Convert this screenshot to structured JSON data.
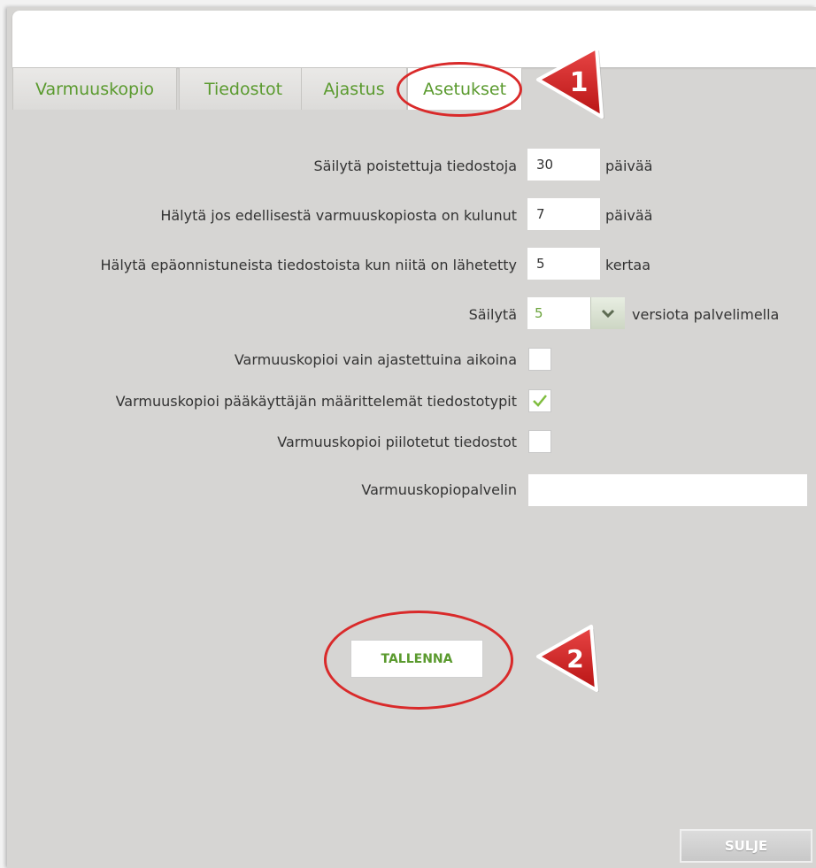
{
  "tabs": [
    {
      "label": "Varmuuskopio"
    },
    {
      "label": "Tiedostot"
    },
    {
      "label": "Ajastus"
    },
    {
      "label": "Asetukset",
      "active": true
    }
  ],
  "settings": {
    "keep_deleted": {
      "label": "Säilytä poistettuja tiedostoja",
      "value": "30",
      "unit": "päivää"
    },
    "alert_last_backup": {
      "label": "Hälytä jos edellisestä varmuuskopiosta on kulunut",
      "value": "7",
      "unit": "päivää"
    },
    "alert_failed": {
      "label": "Hälytä epäonnistuneista tiedostoista kun niitä on lähetetty",
      "value": "5",
      "unit": "kertaa"
    },
    "keep_versions": {
      "label": "Säilytä",
      "value": "5",
      "unit": "versiota palvelimella"
    },
    "scheduled_only": {
      "label": "Varmuuskopioi vain ajastettuina aikoina",
      "checked": false
    },
    "admin_filetypes": {
      "label": "Varmuuskopioi pääkäyttäjän määrittelemät tiedostotypit",
      "checked": true
    },
    "hidden_files": {
      "label": "Varmuuskopioi piilotetut tiedostot",
      "checked": false
    },
    "backup_server": {
      "label": "Varmuuskopiopalvelin",
      "value": ""
    }
  },
  "buttons": {
    "save": "TALLENNA",
    "close": "SULJE"
  },
  "callouts": {
    "first": "1",
    "second": "2"
  },
  "colors": {
    "accent_green": "#5a9a2e",
    "callout_red": "#d92a2a",
    "panel_bg": "#d6d5d3"
  }
}
